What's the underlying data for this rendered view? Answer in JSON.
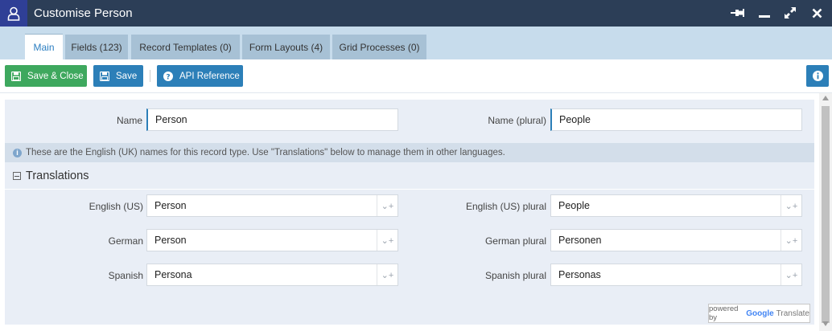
{
  "window": {
    "title": "Customise Person",
    "icons": [
      "user-icon",
      "pin-icon",
      "minimize-icon",
      "maximize-icon",
      "close-icon"
    ]
  },
  "tabs": [
    {
      "label": "Main",
      "active": true
    },
    {
      "label": "Fields (123)",
      "active": false
    },
    {
      "label": "Record Templates (0)",
      "active": false
    },
    {
      "label": "Form Layouts (4)",
      "active": false
    },
    {
      "label": "Grid Processes (0)",
      "active": false
    }
  ],
  "toolbar": {
    "save_close_label": "Save & Close",
    "save_label": "Save",
    "api_reference_label": "API Reference"
  },
  "form": {
    "name_label": "Name",
    "name_value": "Person",
    "name_plural_label": "Name (plural)",
    "name_plural_value": "People"
  },
  "notice": "These are the English (UK) names for this record type. Use \"Translations\" below to manage them in other languages.",
  "translations": {
    "heading": "Translations",
    "rows": [
      {
        "label": "English (US)",
        "value": "Person",
        "plural_label": "English (US) plural",
        "plural_value": "People"
      },
      {
        "label": "German",
        "value": "Person",
        "plural_label": "German plural",
        "plural_value": "Personen"
      },
      {
        "label": "Spanish",
        "value": "Persona",
        "plural_label": "Spanish plural",
        "plural_value": "Personas"
      }
    ]
  },
  "powered_by": {
    "prefix": "powered by",
    "brand": "Google",
    "product": "Translate"
  },
  "colors": {
    "titlebar": "#2c3e57",
    "accent_blue": "#2c7fb8",
    "green": "#3ea85e",
    "tab_bar": "#c7dcec"
  }
}
